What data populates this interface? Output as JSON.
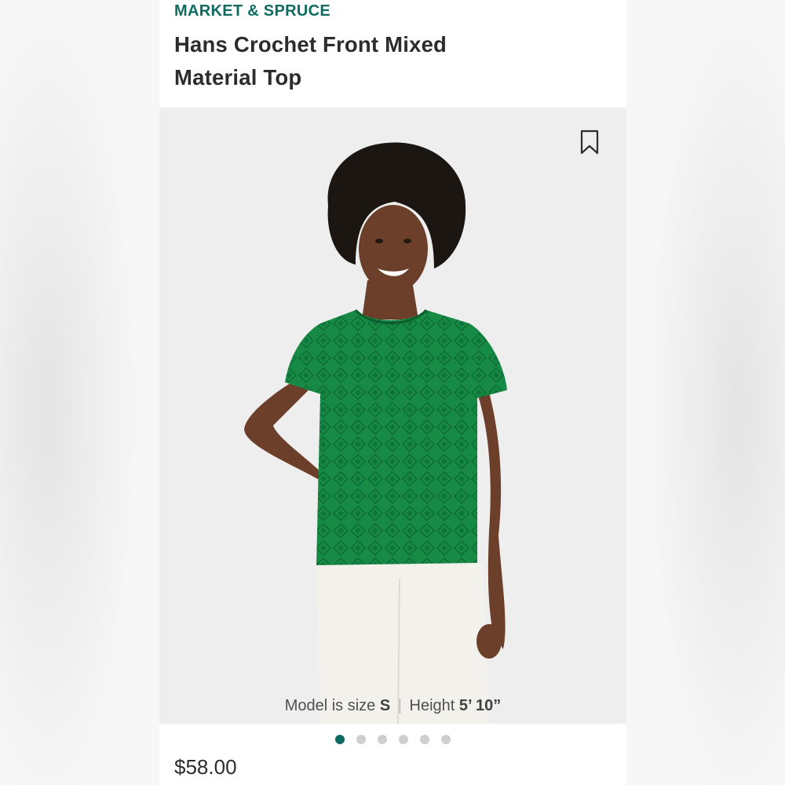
{
  "product": {
    "brand": "MARKET & SPRUCE",
    "title": "Hans Crochet Front Mixed Material Top",
    "price": "$58.00"
  },
  "gallery": {
    "model_size_label": "Model is size",
    "model_size_value": "S",
    "separator": "|",
    "height_label": "Height",
    "height_value": "5’ 10”",
    "slide_count": 6,
    "active_slide": 1
  },
  "colors": {
    "brand": "#0f6b62",
    "top_color": "#178a45",
    "pants_color": "#f2f1ec"
  },
  "icons": {
    "bookmark": "bookmark-icon"
  }
}
